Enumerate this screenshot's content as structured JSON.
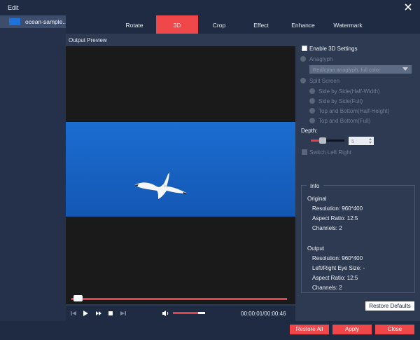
{
  "window": {
    "title": "Edit"
  },
  "file_panel": {
    "items": [
      {
        "name": "ocean-sample..."
      }
    ]
  },
  "tabs": [
    {
      "label": "Rotate",
      "active": false
    },
    {
      "label": "3D",
      "active": true
    },
    {
      "label": "Crop",
      "active": false
    },
    {
      "label": "Effect",
      "active": false
    },
    {
      "label": "Enhance",
      "active": false
    },
    {
      "label": "Watermark",
      "active": false
    }
  ],
  "preview": {
    "label": "Output Preview",
    "progress_fraction": 0.02,
    "volume_fraction": 0.78,
    "time": "00:00:01/00:00:46"
  },
  "settings": {
    "enable_3d": {
      "label": "Enable 3D Settings",
      "checked": false
    },
    "anaglyph": {
      "label": "Anaglyph",
      "select_value": "Red/cyan anaglyph, full color"
    },
    "split_screen": {
      "label": "Split Screen",
      "options": [
        "Side by Side(Half-Width)",
        "Side by Side(Full)",
        "Top and Bottom(Half-Height)",
        "Top and Bottom(Full)"
      ]
    },
    "depth": {
      "label": "Depth:",
      "value": "5",
      "level_fraction": 0.3
    },
    "switch_left_right": {
      "label": "Switch Left Right",
      "checked": false
    }
  },
  "info": {
    "title": "Info",
    "original": {
      "heading": "Original",
      "resolution": "Resolution: 960*400",
      "aspect_ratio": "Aspect Ratio: 12:5",
      "channels": "Channels: 2"
    },
    "output": {
      "heading": "Output",
      "resolution": "Resolution: 960*400",
      "eye_size": "Left/Right Eye Size: -",
      "aspect_ratio": "Aspect Ratio: 12:5",
      "channels": "Channels: 2"
    }
  },
  "buttons": {
    "restore_defaults": "Restore Defaults",
    "restore_all": "Restore All",
    "apply": "Apply",
    "close": "Close"
  },
  "colors": {
    "accent": "#f0474b",
    "titlebar": "#1f2b42",
    "panel": "#2e3a52"
  }
}
